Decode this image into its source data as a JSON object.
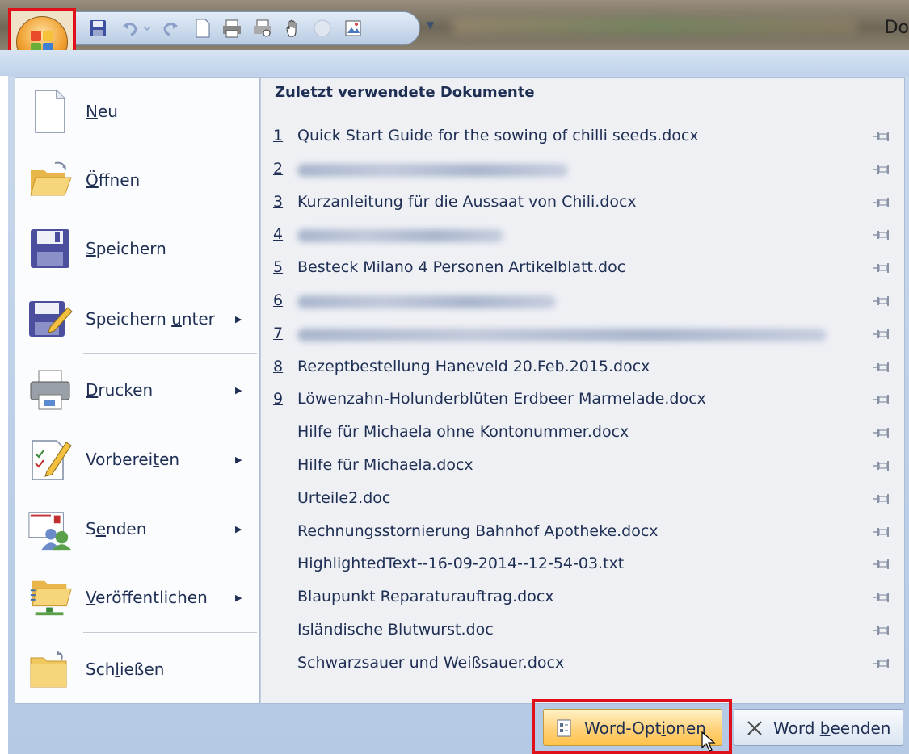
{
  "window": {
    "title_partial": "Do"
  },
  "menu": {
    "items": [
      {
        "key": "new",
        "label_pre": "",
        "label_u": "N",
        "label_post": "eu",
        "has_submenu": false
      },
      {
        "key": "open",
        "label_pre": "",
        "label_u": "Ö",
        "label_post": "ffnen",
        "has_submenu": false
      },
      {
        "key": "save",
        "label_pre": "",
        "label_u": "S",
        "label_post": "peichern",
        "has_submenu": false
      },
      {
        "key": "save-as",
        "label_pre": "Speichern ",
        "label_u": "u",
        "label_post": "nter",
        "has_submenu": true
      },
      {
        "key": "print",
        "label_pre": "",
        "label_u": "D",
        "label_post": "rucken",
        "has_submenu": true
      },
      {
        "key": "prepare",
        "label_pre": "Vorberei",
        "label_u": "t",
        "label_post": "en",
        "has_submenu": true
      },
      {
        "key": "send",
        "label_pre": "S",
        "label_u": "e",
        "label_post": "nden",
        "has_submenu": true
      },
      {
        "key": "publish",
        "label_pre": "",
        "label_u": "V",
        "label_post": "eröffentlichen",
        "has_submenu": true
      },
      {
        "key": "close",
        "label_pre": "Sch",
        "label_u": "l",
        "label_post": "ießen",
        "has_submenu": false
      }
    ],
    "submenu_arrow": "▶"
  },
  "recent": {
    "title": "Zuletzt verwendete Dokumente",
    "items": [
      {
        "num": "1",
        "name": "Quick Start Guide for the sowing of chilli seeds.docx"
      },
      {
        "num": "2",
        "name": ""
      },
      {
        "num": "3",
        "name": "Kurzanleitung für die Aussaat von Chili.docx"
      },
      {
        "num": "4",
        "name": ""
      },
      {
        "num": "5",
        "name": "Besteck Milano 4 Personen Artikelblatt.doc"
      },
      {
        "num": "6",
        "name": ""
      },
      {
        "num": "7",
        "name": ""
      },
      {
        "num": "8",
        "name": "Rezeptbestellung Haneveld 20.Feb.2015.docx"
      },
      {
        "num": "9",
        "name": "Löwenzahn-Holunderblüten Erdbeer Marmelade.docx"
      },
      {
        "num": "",
        "name": "Hilfe für Michaela ohne Kontonummer.docx"
      },
      {
        "num": "",
        "name": "Hilfe für Michaela.docx"
      },
      {
        "num": "",
        "name": "Urteile2.doc"
      },
      {
        "num": "",
        "name": "Rechnungsstornierung Bahnhof Apotheke.docx"
      },
      {
        "num": "",
        "name": "HighlightedText--16-09-2014--12-54-03.txt"
      },
      {
        "num": "",
        "name": "Blaupunkt Reparaturauftrag.docx"
      },
      {
        "num": "",
        "name": "Isländische Blutwurst.doc"
      },
      {
        "num": "",
        "name": "Schwarzsauer und Weißsauer.docx"
      }
    ]
  },
  "buttons": {
    "options": {
      "pre": "Word-Opt",
      "u": "i",
      "post": "onen"
    },
    "exit": {
      "pre": "Word ",
      "u": "b",
      "post": "eenden"
    }
  },
  "colors": {
    "highlight_frame": "#e0101a",
    "text": "#1f2f54",
    "hover_button": "#ffd27a"
  }
}
